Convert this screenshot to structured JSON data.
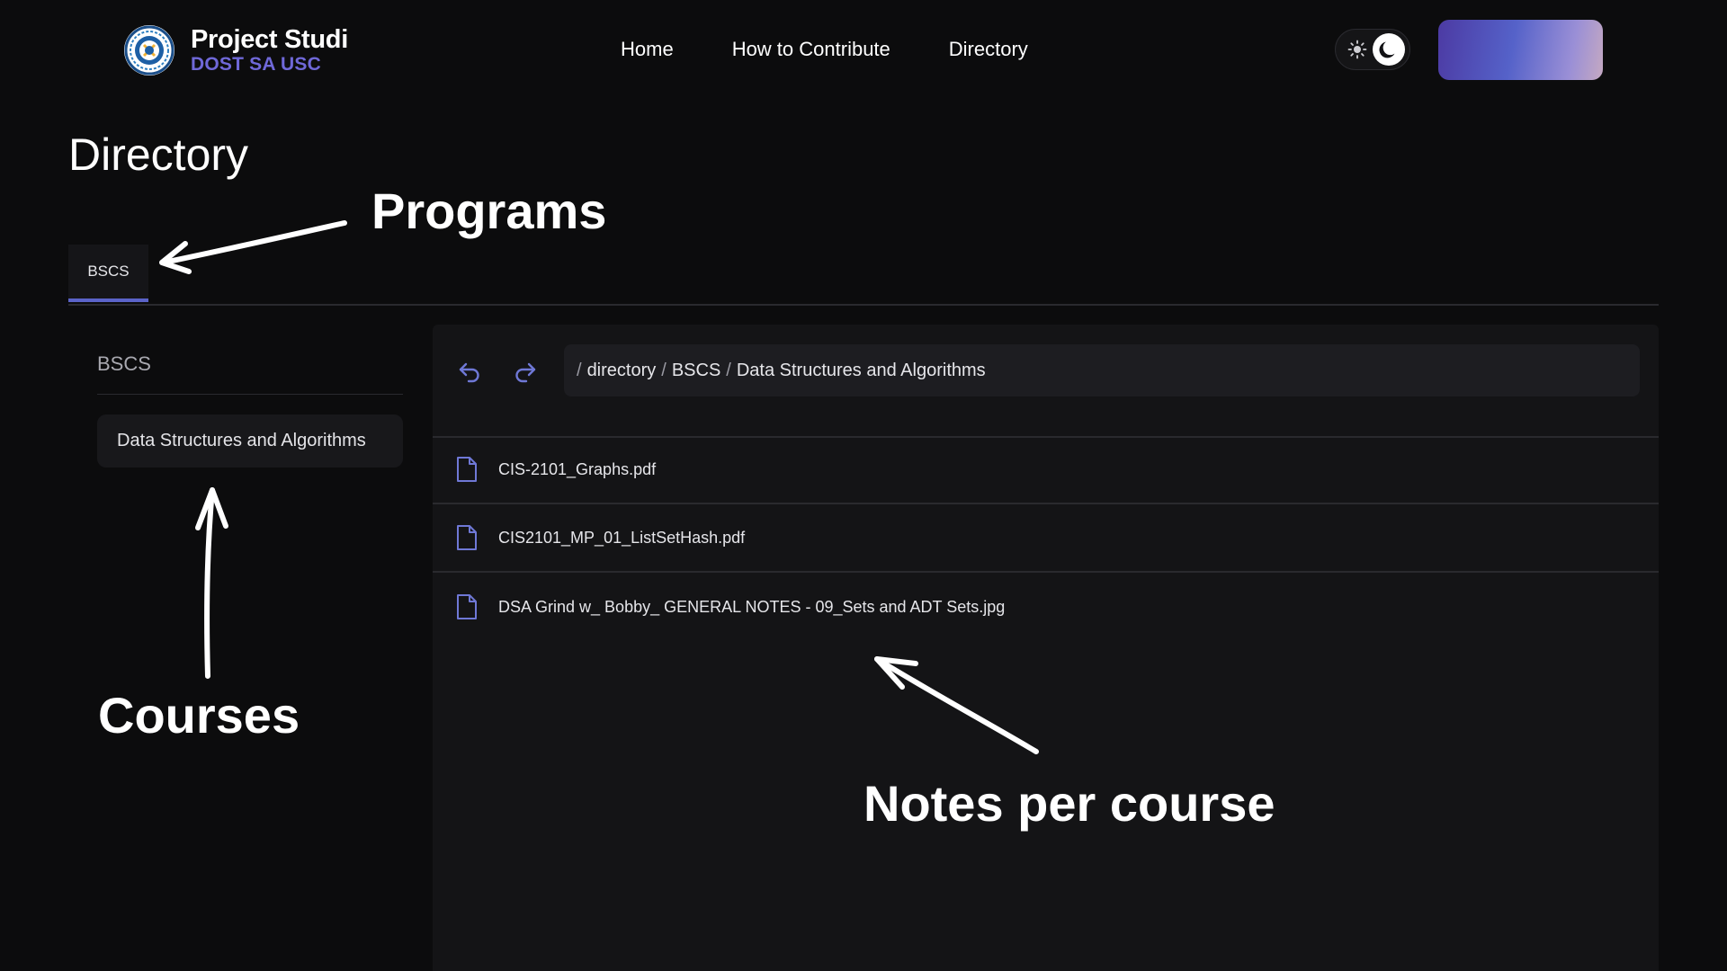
{
  "brand": {
    "title": "Project Studi",
    "subtitle": "DOST SA USC"
  },
  "nav": {
    "items": [
      {
        "label": "Home"
      },
      {
        "label": "How to Contribute"
      },
      {
        "label": "Directory"
      }
    ]
  },
  "page": {
    "title": "Directory"
  },
  "tabs": [
    {
      "label": "BSCS",
      "active": true
    }
  ],
  "sidebar": {
    "heading": "BSCS",
    "items": [
      {
        "label": "Data Structures and Algorithms",
        "selected": true
      }
    ]
  },
  "path": {
    "segments": [
      "directory",
      "BSCS",
      "Data Structures and Algorithms"
    ]
  },
  "files": [
    {
      "name": "CIS-2101_Graphs.pdf",
      "icon": "file-icon"
    },
    {
      "name": "CIS2101_MP_01_ListSetHash.pdf",
      "icon": "file-icon"
    },
    {
      "name": "DSA Grind w_ Bobby_ GENERAL NOTES - 09_Sets and ADT Sets.jpg",
      "icon": "file-icon"
    }
  ],
  "annotations": {
    "programs": "Programs",
    "courses": "Courses",
    "notes": "Notes per course"
  },
  "colors": {
    "background": "#0c0c0d",
    "panel": "#141416",
    "accent": "#5b63c8",
    "brand_subtitle": "#6f68d8"
  },
  "icons": [
    "logo-icon",
    "sun-icon",
    "moon-icon",
    "undo-icon",
    "redo-icon",
    "file-icon"
  ]
}
